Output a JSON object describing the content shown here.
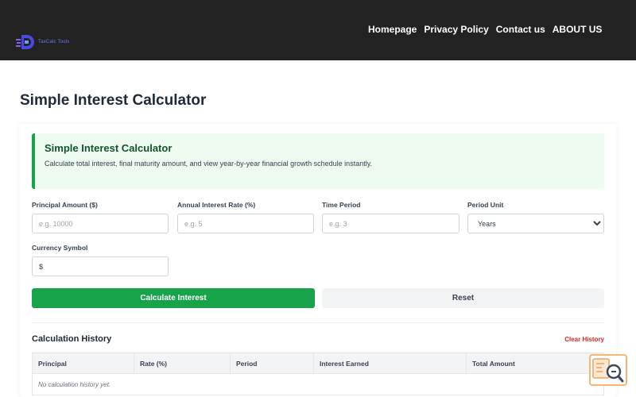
{
  "header": {
    "logo_text": "TaxCalc Tools",
    "nav": [
      "Homepage",
      "Privacy Policy",
      "Contact us",
      "ABOUT US"
    ]
  },
  "page": {
    "title": "Simple Interest Calculator"
  },
  "info": {
    "title": "Simple Interest Calculator",
    "description": "Calculate total interest, final maturity amount, and view year-by-year financial growth schedule instantly."
  },
  "form": {
    "principal": {
      "label": "Principal Amount ($)",
      "placeholder": "e.g. 10000"
    },
    "rate": {
      "label": "Annual Interest Rate (%)",
      "placeholder": "e.g. 5"
    },
    "period": {
      "label": "Time Period",
      "placeholder": "e.g. 3"
    },
    "unit": {
      "label": "Period Unit",
      "selected": "Years"
    },
    "currency": {
      "label": "Currency Symbol",
      "value": "$"
    }
  },
  "buttons": {
    "calculate": "Calculate Interest",
    "reset": "Reset"
  },
  "history": {
    "title": "Calculation History",
    "clear_label": "Clear History",
    "columns": [
      "Principal",
      "Rate (%)",
      "Period",
      "Interest Earned",
      "Total Amount"
    ],
    "empty_message": "No calculation history yet."
  },
  "colors": {
    "header_bg": "#222222",
    "primary": "#16a34a",
    "info_bg": "#edfbf0",
    "danger": "#dc2626",
    "logo_accent": "#4f46e5"
  },
  "icons": {
    "logo": "calculator-logo-icon",
    "widget": "search-document-icon"
  }
}
